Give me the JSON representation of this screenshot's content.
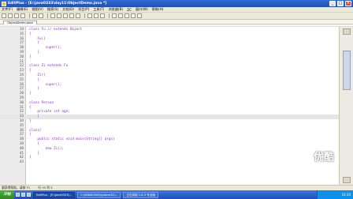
{
  "window": {
    "title": "EditPlus - [E:\\java0333\\day11\\ObjectDemo.java *]",
    "minimize": "_",
    "maximize": "□",
    "close": "×"
  },
  "menu": [
    "文件(F)",
    "编辑(E)",
    "视图(V)",
    "搜索(S)",
    "文档(D)",
    "项目(P)",
    "工具(T)",
    "浏览器(B)",
    "ZC",
    "窗口(W)",
    "帮助(H)"
  ],
  "tab": {
    "label": "ObjectDemo.java"
  },
  "editor": {
    "lines": [
      {
        "n": "14",
        "code": "class Fu // extends Object"
      },
      {
        "n": "15",
        "code": "{"
      },
      {
        "n": "16",
        "code": "    Fu()"
      },
      {
        "n": "17",
        "code": "    {"
      },
      {
        "n": "18",
        "code": "        super();"
      },
      {
        "n": "19",
        "code": "    }"
      },
      {
        "n": "20",
        "code": "}"
      },
      {
        "n": "21",
        "code": ""
      },
      {
        "n": "22",
        "code": "class Zi extends Fu"
      },
      {
        "n": "23",
        "code": "{"
      },
      {
        "n": "24",
        "code": "    Zi()"
      },
      {
        "n": "25",
        "code": "    {"
      },
      {
        "n": "26",
        "code": "        super();"
      },
      {
        "n": "27",
        "code": "    }"
      },
      {
        "n": "28",
        "code": "}"
      },
      {
        "n": "29",
        "code": ""
      },
      {
        "n": "30",
        "code": "class Person"
      },
      {
        "n": "31",
        "code": "{"
      },
      {
        "n": "32",
        "code": "    private int age;"
      },
      {
        "n": "33",
        "code": "    |"
      },
      {
        "n": "34",
        "code": "}"
      },
      {
        "n": "35",
        "code": ""
      },
      {
        "n": "36",
        "code": "class["
      },
      {
        "n": "37",
        "code": "{"
      },
      {
        "n": "38",
        "code": "    public static void main(String[] args)"
      },
      {
        "n": "39",
        "code": "    {"
      },
      {
        "n": "40",
        "code": "        new Zi();"
      },
      {
        "n": "41",
        "code": "    }"
      },
      {
        "n": "42",
        "code": "}"
      },
      {
        "n": "43",
        "code": ""
      }
    ],
    "current_line_index": 19
  },
  "status": {
    "help": "要获得帮助，请按 F1",
    "position": "行 33  列 5"
  },
  "taskbar": {
    "start": "开始",
    "tasks": [
      "EditPlus - [E:\\java0333\\...",
      "C:\\WINDOWS\\system32\\...",
      "正在录制 1.8.3 专业版"
    ],
    "clock": "10:30"
  },
  "watermark": "优酷"
}
